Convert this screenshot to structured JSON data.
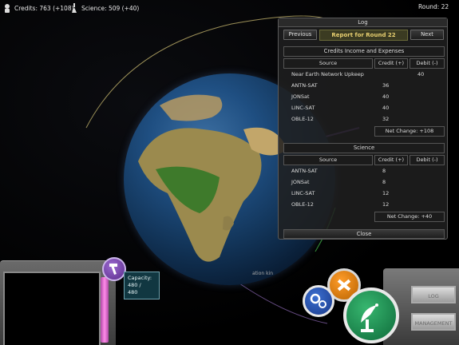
{
  "hud": {
    "credits_label": "Credits: 763 (+108)",
    "science_label": "Science: 509 (+40)",
    "round_label": "Round: 22"
  },
  "log": {
    "title": "Log",
    "previous_label": "Previous",
    "report_label": "Report for Round 22",
    "next_label": "Next",
    "credits_section_title": "Credits Income and Expenses",
    "credits_headers": {
      "source": "Source",
      "credit": "Credit (+)",
      "debit": "Debit (-)"
    },
    "credits_rows": [
      {
        "source": "Near Earth Network Upkeep",
        "credit": "",
        "debit": "40"
      },
      {
        "source": "ANTN-SAT",
        "credit": "36",
        "debit": ""
      },
      {
        "source": "JONSat",
        "credit": "40",
        "debit": ""
      },
      {
        "source": "LINC-SAT",
        "credit": "40",
        "debit": ""
      },
      {
        "source": "OBLE-12",
        "credit": "32",
        "debit": ""
      }
    ],
    "credits_net": "Net Change: +108",
    "science_section_title": "Science",
    "science_headers": {
      "source": "Source",
      "credit": "Credit (+)",
      "debit": "Debit (-)"
    },
    "science_rows": [
      {
        "source": "ANTN-SAT",
        "credit": "8",
        "debit": ""
      },
      {
        "source": "JONSat",
        "credit": "8",
        "debit": ""
      },
      {
        "source": "LINC-SAT",
        "credit": "12",
        "debit": ""
      },
      {
        "source": "OBLE-12",
        "credit": "12",
        "debit": ""
      }
    ],
    "science_net": "Net Change: +40",
    "close_label": "Close"
  },
  "capacity": {
    "label": "Capacity:",
    "value": "480 /",
    "max": "480"
  },
  "right_buttons": {
    "log_label": "LOG",
    "management_label": "MANAGEMENT"
  },
  "ghost_text": "ation kin",
  "colors": {
    "panel_bg": "#202020",
    "report_text": "#e8d070",
    "pink_bar": "#ff8be8",
    "tool_orange": "#ff9d2a",
    "gear_blue": "#3b6fd0",
    "sat_green": "#37b66f"
  }
}
